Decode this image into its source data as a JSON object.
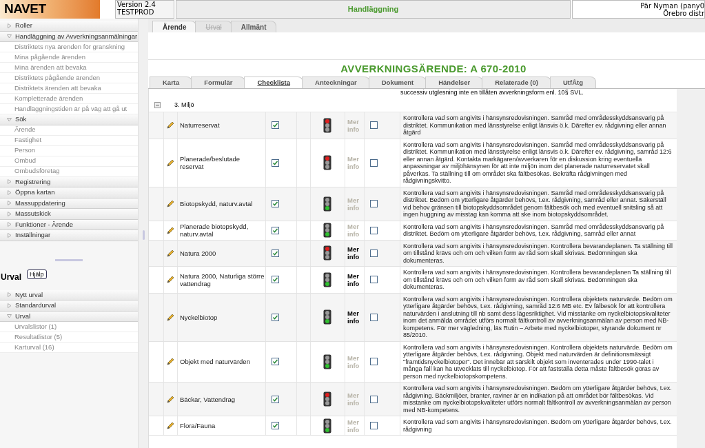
{
  "header": {
    "logo": "NAVET",
    "version": "Version 2.4",
    "environment": "TESTPROD",
    "module": "Handläggning",
    "user": "Pär Nyman (pany0",
    "district": "Örebro distr"
  },
  "sidebar": {
    "sections": [
      {
        "label": "Roller",
        "expanded": false
      },
      {
        "label": "Handläggning av Avverkningsanmälningar",
        "expanded": true,
        "children": [
          "Distriktets nya ärenden för granskning",
          "Mina pågående ärenden",
          "Mina ärenden att bevaka",
          "Distriktets pågående ärenden",
          "Distriktets ärenden att bevaka",
          "Kompletterade ärenden",
          "Handläggningstiden är på väg att gå ut"
        ]
      },
      {
        "label": "Sök",
        "expanded": true,
        "children": [
          "Ärende",
          "Fastighet",
          "Person",
          "Ombud",
          "Ombudsföretag"
        ]
      },
      {
        "label": "Registrering",
        "expanded": false
      },
      {
        "label": "Öppna kartan",
        "expanded": false
      },
      {
        "label": "Massuppdatering",
        "expanded": false
      },
      {
        "label": "Massutskick",
        "expanded": false
      },
      {
        "label": "Funktioner - Ärende",
        "expanded": false
      },
      {
        "label": "Inställningar",
        "expanded": false
      }
    ]
  },
  "urval": {
    "title": "Urval",
    "help_button": "Hjälp",
    "sections": [
      {
        "label": "Nytt urval",
        "expanded": false
      },
      {
        "label": "Standardurval",
        "expanded": false
      },
      {
        "label": "Urval",
        "expanded": true,
        "children": [
          "Urvalslistor (1)",
          "Resultatlistor (5)",
          "Karturval (16)"
        ]
      }
    ]
  },
  "top_tabs": [
    {
      "label": "Ärende",
      "selected": true,
      "disabled": false
    },
    {
      "label": "Urval",
      "selected": false,
      "disabled": true
    },
    {
      "label": "Allmänt",
      "selected": false,
      "disabled": false
    }
  ],
  "case_title": "AVVERKNINGSÄRENDE: A 670-2010",
  "case_tabs": [
    {
      "label": "Karta",
      "selected": false
    },
    {
      "label": "Formulär",
      "selected": false
    },
    {
      "label": "Checklista",
      "selected": true
    },
    {
      "label": "Anteckningar",
      "selected": false
    },
    {
      "label": "Dokument",
      "selected": false
    },
    {
      "label": "Händelser",
      "selected": false
    },
    {
      "label": "Relaterade (0)",
      "selected": false
    },
    {
      "label": "UtfÅtg",
      "selected": false
    }
  ],
  "checklist": {
    "partial_row_text": "successiv utglesning inte en tillåten avverkningsform enl. 10§ SVL.",
    "group": {
      "label": "3. Miljö",
      "expanded": true
    },
    "rows": [
      {
        "name": "Naturreservat",
        "checked": true,
        "warning": true,
        "more_info": "Mer info",
        "more_info_enabled": false,
        "noted": false,
        "description": "Kontrollera vad som angivits i hänsynsredovisningen. Samråd med områdesskyddsansvarig på distriktet. Kommunikation med länsstyrelse enligt länsvis ö.k. Därefter ev. rådgivning eller annan åtgärd"
      },
      {
        "name": "Planerade/beslutade reservat",
        "checked": true,
        "warning": true,
        "more_info": "Mer info",
        "more_info_enabled": false,
        "noted": false,
        "description": "Kontrollera vad som angivits i hänsynsredovisningen. Samråd med områdesskyddsansvarig på distriktet. Kommunikation med länsstyrelse enligt länsvis ö.k. Därefter ev. rådgivning, samråd 12:6 eller annan åtgärd. Kontakta markägaren/avverkaren för en diskussion kring eventuella anpassningar av miljöhänsynen för att inte miljön inom det planerade naturreservatet skall påverkas. Ta ställning till om området ska fältbesökas. Bekräfta rådgivningen med rådgivningskvitto."
      },
      {
        "name": "Biotopskydd, naturv.avtal",
        "checked": true,
        "warning": false,
        "more_info": "Mer info",
        "more_info_enabled": false,
        "noted": false,
        "description": "Kontrollera vad som angivits i hänsynsredovisningen. Samråd med områdesskyddsansvarig på distriktet. Bedöm om ytterligare åtgärder behövs, t.ex. rådgivning, samråd eller annat. Säkerställ vid behov gränsen till biotopskyddsområdet genom fältbesök och med eventuell snitsling så att ingen huggning av misstag kan komma att ske inom biotopskyddsområdet."
      },
      {
        "name": "Planerade biotopskydd, naturv.avtal",
        "checked": true,
        "warning": false,
        "more_info": "Mer info",
        "more_info_enabled": false,
        "noted": false,
        "description": "Kontrollera vad som angivits i hänsynsredovisningen. Samråd med områdesskyddsansvarig på distriktet. Bedöm om ytterligare åtgärder behövs, t.ex. rådgivning, samråd eller annat"
      },
      {
        "name": "Natura 2000",
        "checked": true,
        "warning": true,
        "more_info": "Mer info",
        "more_info_enabled": true,
        "noted": false,
        "description": "Kontrollera vad som angivits i hänsynsredovisningen. Kontrollera bevarandeplanen. Ta ställning till om tillstånd krävs och om och vilken form av råd som skall skrivas. Bedömningen ska dokumenteras."
      },
      {
        "name": "Natura 2000, Naturliga större vattendrag",
        "checked": true,
        "warning": false,
        "more_info": "Mer info",
        "more_info_enabled": true,
        "noted": false,
        "description": "Kontrollera vad som angivits i hänsynsredovisningen. Kontrollera bevarandeplanen Ta ställning till om tillstånd krävs och om och vilken form av råd som skall skrivas. Bedömningen ska dokumenteras."
      },
      {
        "name": "Nyckelbiotop",
        "checked": true,
        "warning": false,
        "more_info": "Mer info",
        "more_info_enabled": true,
        "noted": false,
        "description": "Kontrollera vad som angivits i hänsynsredovisningen. Kontrollera objektets naturvärde. Bedöm om ytterligare åtgärder behövs, t.ex. rådgivning, samråd 12:6 MB etc. Ev fälbesök för att kontrollera naturvärden i anslutning till nb samt dess lägesriktighet. Vid misstanke om nyckelbiotopskvaliteter inom det anmälda området utförs normalt fältkontroll av avverkningsanmälan av person med NB-kompetens. För mer vägledning, läs Rutin – Arbete med nyckelbiotoper, styrande dokument nr 85/2010."
      },
      {
        "name": "Objekt med naturvärden",
        "checked": true,
        "warning": false,
        "more_info": "Mer info",
        "more_info_enabled": false,
        "noted": false,
        "description": "Kontrollera vad som angivits i hänsynsredovisningen. Kontrollera objektets naturvärde. Bedöm om ytterligare åtgärder behövs, t.ex. rådgivning. Objekt med naturvärden är definitionsmässigt \"framtidsnyckelbiotoper\". Det innebär att särskilt objekt som inventerades under 1990-talet i många fall kan ha utvecklats till nyckelbiotop. För att fastställa detta måste fältbesök göras av person med nyckelbiotopskompetens."
      },
      {
        "name": "Bäckar, Vattendrag",
        "checked": true,
        "warning": true,
        "more_info": "Mer info",
        "more_info_enabled": false,
        "noted": false,
        "description": "Kontrollera vad som angivits i hänsynsredovisningen. Bedöm om ytterligare åtgärder behövs, t.ex. rådgivning. Bäckmiljöer, branter, raviner är en indikation på att området bör fältbesökas. Vid misstanke om nyckelbiotopskvaliteter utförs normalt fältkontroll av avverkningsanmälan av person med NB-kompetens."
      },
      {
        "name": "Flora/Fauna",
        "checked": true,
        "warning": false,
        "more_info": "Mer info",
        "more_info_enabled": false,
        "noted": false,
        "description": "Kontrollera vad som angivits i hänsynsredovisningen. Bedöm om ytterligare åtgärder behövs, t.ex. rådgivning"
      }
    ]
  }
}
